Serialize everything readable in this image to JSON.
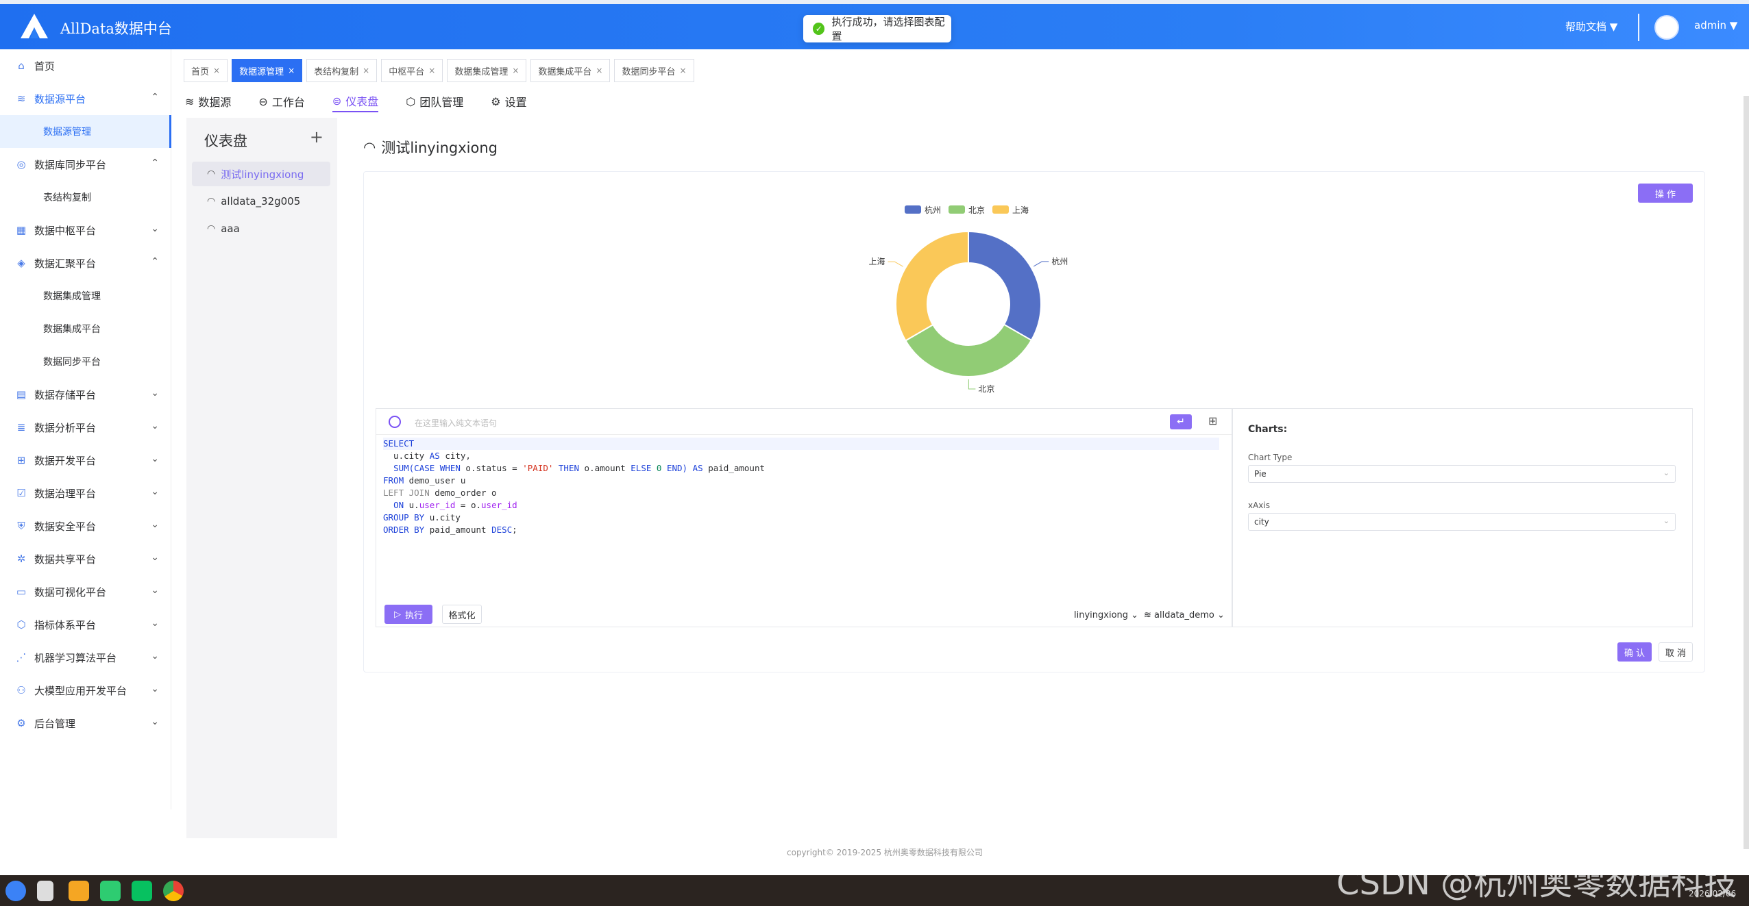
{
  "app": {
    "brand": "AllData数据中台",
    "help": "帮助文档",
    "user": "admin"
  },
  "toast": {
    "text": "执行成功，请选择图表配置"
  },
  "sidebar": {
    "items": [
      {
        "label": "首页"
      },
      {
        "label": "数据源平台"
      },
      {
        "label": "数据源管理"
      },
      {
        "label": "数据库同步平台"
      },
      {
        "label": "表结构复制"
      },
      {
        "label": "数据中枢平台"
      },
      {
        "label": "数据汇聚平台"
      },
      {
        "label": "数据集成管理"
      },
      {
        "label": "数据集成平台"
      },
      {
        "label": "数据同步平台"
      },
      {
        "label": "数据存储平台"
      },
      {
        "label": "数据分析平台"
      },
      {
        "label": "数据开发平台"
      },
      {
        "label": "数据治理平台"
      },
      {
        "label": "数据安全平台"
      },
      {
        "label": "数据共享平台"
      },
      {
        "label": "数据可视化平台"
      },
      {
        "label": "指标体系平台"
      },
      {
        "label": "机器学习算法平台"
      },
      {
        "label": "大模型应用开发平台"
      },
      {
        "label": "后台管理"
      }
    ]
  },
  "tabs": [
    "首页",
    "数据源管理",
    "表结构复制",
    "中枢平台",
    "数据集成管理",
    "数据集成平台",
    "数据同步平台"
  ],
  "subnav": [
    "数据源",
    "工作台",
    "仪表盘",
    "团队管理",
    "设置"
  ],
  "dashboards": {
    "title": "仪表盘",
    "items": [
      "测试linyingxiong",
      "alldata_32g005",
      "aaa"
    ]
  },
  "main": {
    "title": "测试linyingxiong",
    "op_button": "操 作",
    "editor_placeholder": "在这里输入纯文本语句",
    "run": "执行",
    "format": "格式化",
    "user_select": "linyingxiong",
    "db_select": "alldata_demo",
    "confirm": "确 认",
    "cancel": "取 消"
  },
  "sql": [
    "SELECT",
    "  u.city AS city,",
    "  SUM(CASE WHEN o.status = 'PAID' THEN o.amount ELSE 0 END) AS paid_amount",
    "FROM demo_user u",
    "LEFT JOIN demo_order o",
    "  ON u.user_id = o.user_id",
    "GROUP BY u.city",
    "ORDER BY paid_amount DESC;"
  ],
  "config": {
    "title": "Charts:",
    "chart_type_label": "Chart Type",
    "chart_type_value": "Pie",
    "xaxis_label": "xAxis",
    "xaxis_value": "city"
  },
  "chart_data": {
    "type": "pie",
    "categories": [
      "杭州",
      "北京",
      "上海"
    ],
    "values": [
      33.3,
      33.3,
      33.4
    ],
    "colors": [
      "#5470c6",
      "#91cc75",
      "#fac858"
    ],
    "legend_position": "top-center"
  },
  "footer": {
    "copyright": "copyright© 2019-2025 杭州奥零数据科技有限公司"
  },
  "watermark": "CSDN @杭州奥零数据科技",
  "clock": "2026/02/06"
}
